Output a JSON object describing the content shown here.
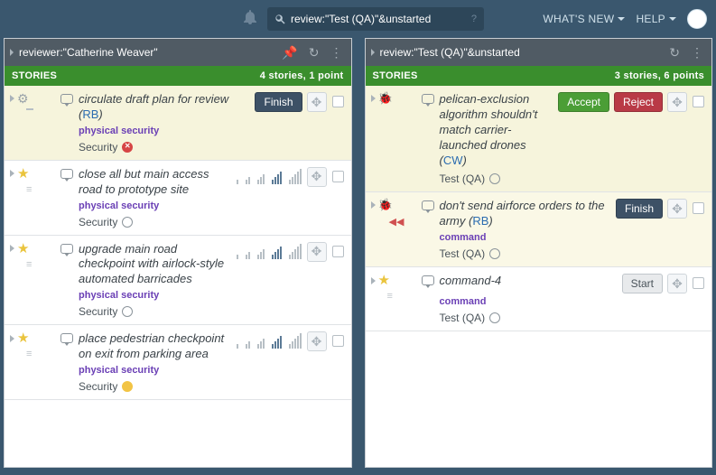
{
  "top": {
    "search_value": "review:\"Test (QA)\"&unstarted",
    "menu_whatsnew": "WHAT'S NEW",
    "menu_help": "HELP"
  },
  "panels": [
    {
      "title": "reviewer:\"Catherine Weaver\"",
      "stories_label": "STORIES",
      "summary": "4 stories, 1 point",
      "stories": [
        {
          "icon": "gear",
          "highlight": "h1",
          "title_pre": "circulate draft plan for review (",
          "owner": "RB",
          "title_post": ")",
          "buttons": [
            {
              "kind": "finish",
              "label": "Finish"
            }
          ],
          "epic": "physical security",
          "label": "Security",
          "state": "red",
          "pointbars": false
        },
        {
          "icon": "star",
          "highlight": "",
          "title_pre": "close all but main access road to prototype site",
          "owner": "",
          "title_post": "",
          "buttons": [],
          "epic": "physical security",
          "label": "Security",
          "state": "empty",
          "pointbars": true
        },
        {
          "icon": "star",
          "highlight": "",
          "title_pre": "upgrade main road checkpoint with airlock-style automated barricades",
          "owner": "",
          "title_post": "",
          "buttons": [],
          "epic": "physical security",
          "label": "Security",
          "state": "empty",
          "pointbars": true
        },
        {
          "icon": "star",
          "highlight": "",
          "title_pre": "place pedestrian checkpoint on exit from parking area",
          "owner": "",
          "title_post": "",
          "buttons": [],
          "epic": "physical security",
          "label": "Security",
          "state": "yellow",
          "pointbars": true
        }
      ]
    },
    {
      "title": "review:\"Test (QA)\"&unstarted",
      "stories_label": "STORIES",
      "summary": "3 stories, 6 points",
      "stories": [
        {
          "icon": "bug-green",
          "highlight": "h1",
          "title_pre": "pelican-exclusion algorithm shouldn't match carrier-launched drones (",
          "owner": "CW",
          "title_post": ")",
          "buttons": [
            {
              "kind": "accept",
              "label": "Accept"
            },
            {
              "kind": "reject",
              "label": "Reject"
            }
          ],
          "epic": "",
          "label": "Test (QA)",
          "state": "empty",
          "pointbars": false
        },
        {
          "icon": "bug-red",
          "highlight": "h2",
          "left_arrows": true,
          "title_pre": "don't send airforce orders to the army (",
          "owner": "RB",
          "title_post": ")",
          "buttons": [
            {
              "kind": "finish",
              "label": "Finish"
            }
          ],
          "epic": "command",
          "label": "Test (QA)",
          "state": "empty",
          "pointbars": false
        },
        {
          "icon": "star",
          "highlight": "",
          "title_pre": "command-4",
          "owner": "",
          "title_post": "",
          "buttons": [
            {
              "kind": "start",
              "label": "Start"
            }
          ],
          "epic": "command",
          "label": "Test (QA)",
          "state": "empty",
          "pointbars": false
        }
      ]
    }
  ]
}
